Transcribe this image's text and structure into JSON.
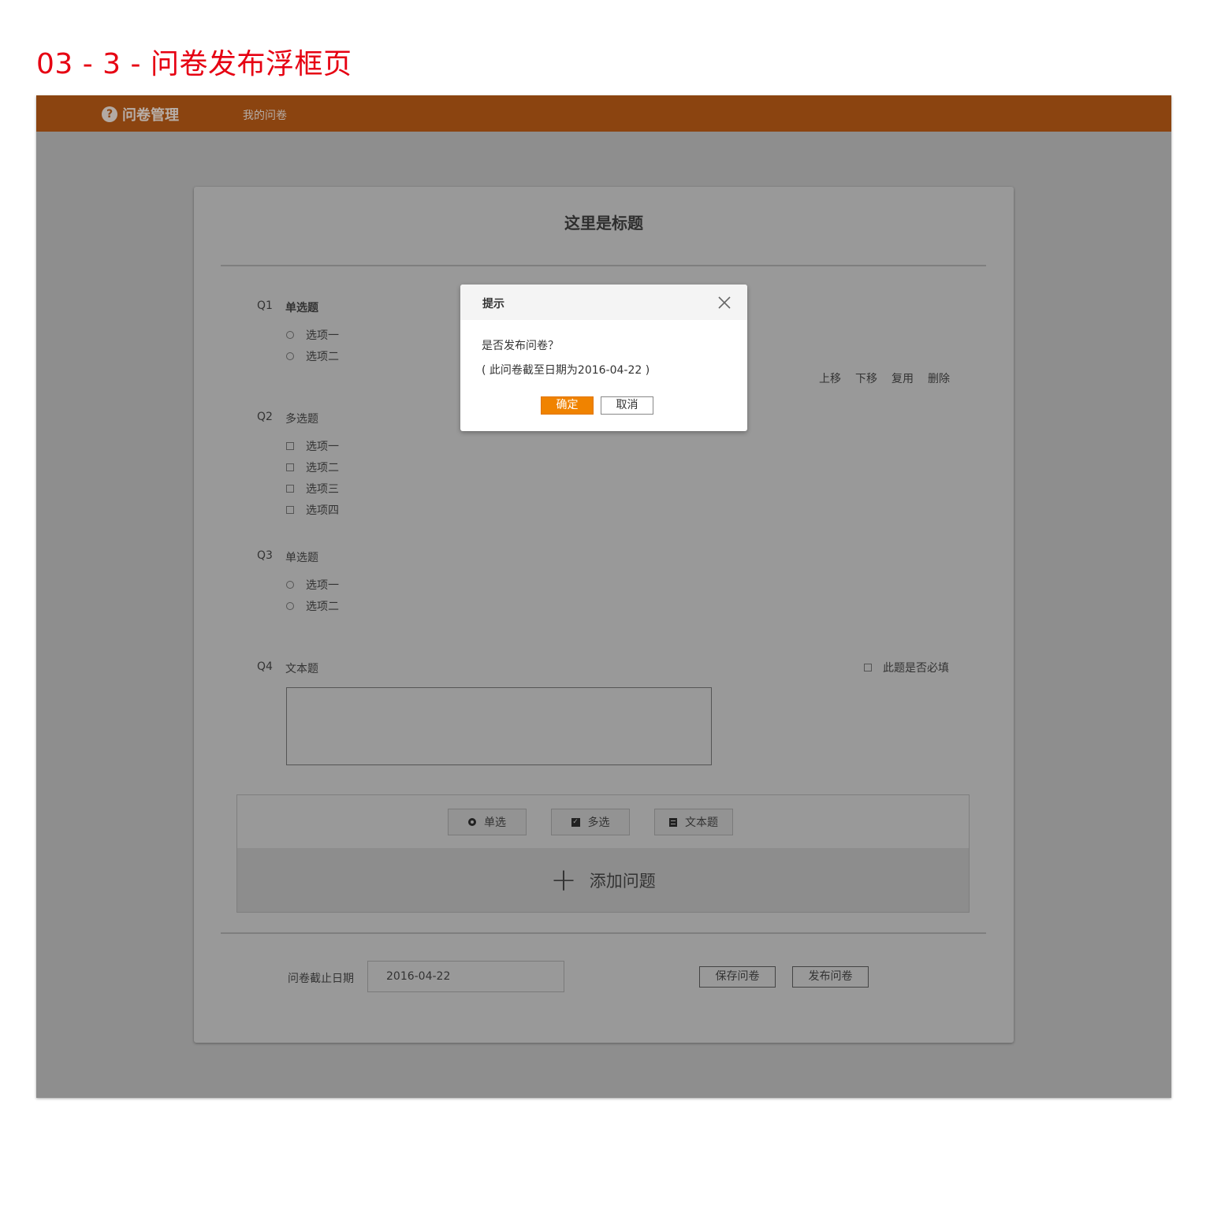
{
  "page_heading": "03 - 3 - 问卷发布浮框页",
  "topbar": {
    "brand_icon_glyph": "?",
    "brand": "问卷管理",
    "nav_link": "我的问卷",
    "color": "#8b4410"
  },
  "survey": {
    "title": "这里是标题",
    "questions": [
      {
        "num": "Q1",
        "type": "单选题",
        "options": [
          "选项一",
          "选项二"
        ]
      },
      {
        "num": "Q2",
        "type": "多选题",
        "options": [
          "选项一",
          "选项二",
          "选项三",
          "选项四"
        ]
      },
      {
        "num": "Q3",
        "type": "单选题",
        "options": [
          "选项一",
          "选项二"
        ]
      },
      {
        "num": "Q4",
        "type": "文本题",
        "required_label": "此题是否必填"
      }
    ],
    "actions": {
      "move_up": "上移",
      "move_down": "下移",
      "reuse": "复用",
      "delete": "删除"
    }
  },
  "add_panel": {
    "types": [
      "单选",
      "多选",
      "文本题"
    ],
    "checkbox_glyph": "✓",
    "plus_glyph": "+",
    "add_label": "添加问题"
  },
  "footer": {
    "deadline_label": "问卷截止日期",
    "deadline_value": "2016-04-22",
    "save_label": "保存问卷",
    "publish_label": "发布问卷"
  },
  "dialog": {
    "title": "提示",
    "message": "是否发布问卷？",
    "note": "( 此问卷截至日期为2016-04-22 )",
    "ok_label": "确定",
    "cancel_label": "取消",
    "close_icon": "close-icon",
    "accent": "#f08300"
  }
}
